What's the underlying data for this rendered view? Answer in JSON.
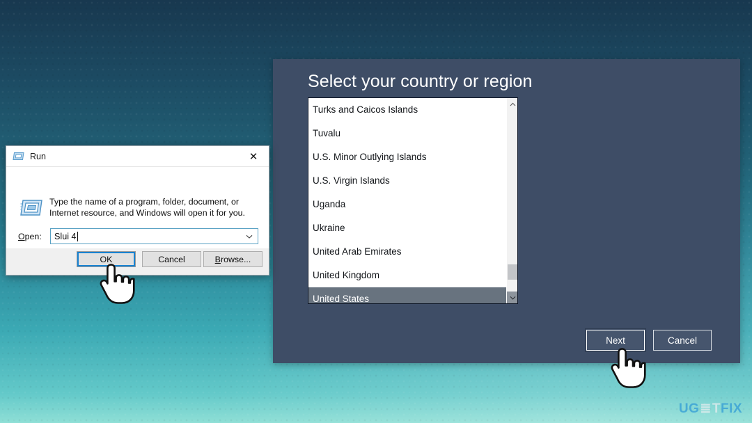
{
  "desktop": {
    "background_top_color": "#18384f",
    "background_bottom_color": "#8fdfd6"
  },
  "country_panel": {
    "title": "Select your country or region",
    "panel_color": "#3e4d66",
    "selected_value": "United States",
    "list_items": [
      {
        "label": "Turks and Caicos Islands",
        "selected": false
      },
      {
        "label": "Tuvalu",
        "selected": false
      },
      {
        "label": "U.S. Minor Outlying Islands",
        "selected": false
      },
      {
        "label": "U.S. Virgin Islands",
        "selected": false
      },
      {
        "label": "Uganda",
        "selected": false
      },
      {
        "label": "Ukraine",
        "selected": false
      },
      {
        "label": "United Arab Emirates",
        "selected": false
      },
      {
        "label": "United Kingdom",
        "selected": false
      },
      {
        "label": "United States",
        "selected": true
      }
    ],
    "scrollbar": {
      "up_arrow_icon": "chevron-up-icon",
      "down_arrow_icon": "chevron-down-icon"
    },
    "buttons": {
      "next_label": "Next",
      "cancel_label": "Cancel"
    }
  },
  "run_dialog": {
    "title": "Run",
    "title_icon": "run-window-icon",
    "close_icon": "close-icon",
    "description": "Type the name of a program, folder, document, or Internet resource, and Windows will open it for you.",
    "open_label_prefix": "O",
    "open_label_rest": "pen:",
    "input_value": "Slui 4",
    "input_placeholder": "",
    "combo_arrow_icon": "chevron-down-icon",
    "buttons": {
      "ok_label": "OK",
      "cancel_label": "Cancel",
      "browse_label_prefix": "B",
      "browse_label_rest": "rowse..."
    }
  },
  "cursors": {
    "ok_cursor_icon": "pointing-hand-cursor",
    "next_cursor_icon": "pointing-hand-cursor"
  },
  "watermark": {
    "part_u": "U",
    "part_g": "G",
    "part_mid": "≣",
    "part_t": "T",
    "part_fix": "FIX",
    "accent_color": "#2f9ad6"
  }
}
